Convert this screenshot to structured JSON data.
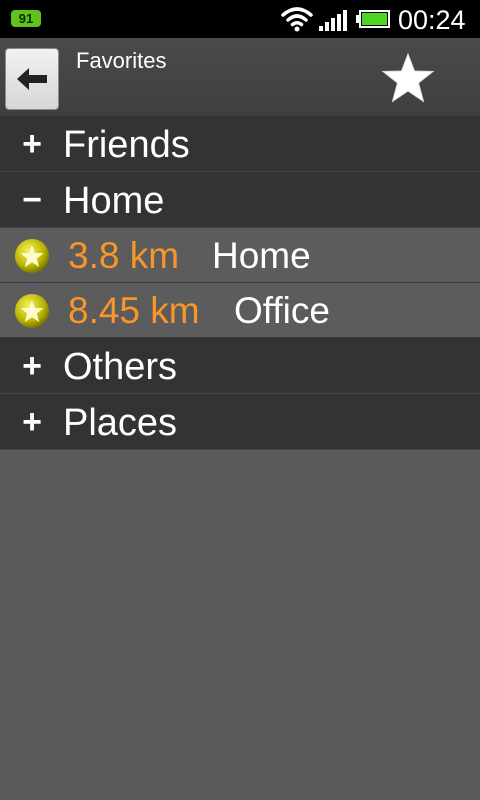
{
  "status_bar": {
    "badge": "91",
    "time": "00:24",
    "icons": [
      "wifi-icon",
      "signal-icon",
      "battery-icon"
    ],
    "badge_color": "#5fc21d"
  },
  "header": {
    "title": "Favorites",
    "back_icon": "back-arrow-icon",
    "action_icon": "star-icon"
  },
  "list": {
    "groups": [
      {
        "sign": "+",
        "label": "Friends"
      },
      {
        "sign": "−",
        "label": "Home"
      },
      {
        "sign": "+",
        "label": "Others"
      },
      {
        "sign": "+",
        "label": "Places"
      }
    ],
    "home_items": [
      {
        "distance": "3.8 km",
        "name": "Home",
        "icon": "favorite-star-icon"
      },
      {
        "distance": "8.45 km",
        "name": "Office",
        "icon": "favorite-star-icon"
      }
    ]
  },
  "colors": {
    "accent_distance": "#f7962a",
    "group_background": "#333333",
    "item_background": "#5c5c5c"
  }
}
